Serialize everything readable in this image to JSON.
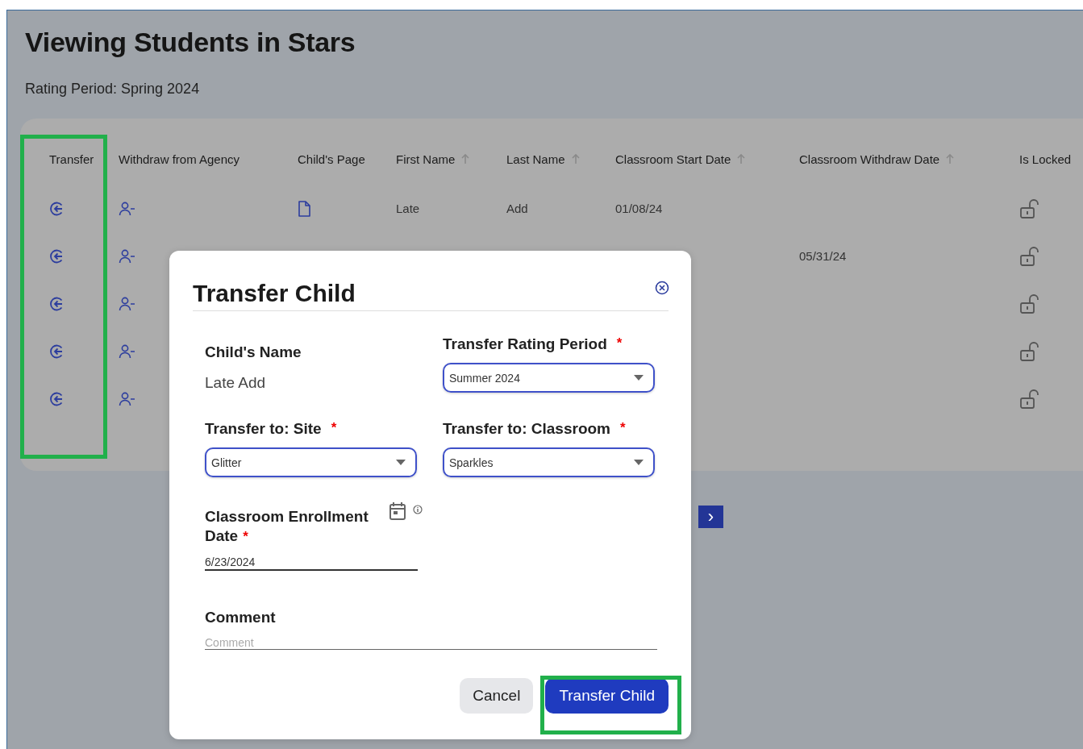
{
  "page": {
    "title": "Viewing Students in Stars",
    "subtitle": "Rating Period: Spring 2024"
  },
  "table": {
    "columns": [
      {
        "label": "Transfer",
        "sortable": false
      },
      {
        "label": "Withdraw from Agency",
        "sortable": false
      },
      {
        "label": "Child's Page",
        "sortable": false
      },
      {
        "label": "First Name",
        "sortable": true
      },
      {
        "label": "Last Name",
        "sortable": true
      },
      {
        "label": "Classroom Start Date",
        "sortable": true
      },
      {
        "label": "Classroom Withdraw Date",
        "sortable": true
      },
      {
        "label": "Is Locked",
        "sortable": false
      }
    ],
    "rows": [
      {
        "page_link": true,
        "first_name": "Late",
        "last_name": "Add",
        "start_date": "01/08/24",
        "locked": false
      },
      {
        "withdraw_date": "05/31/24",
        "locked": false
      },
      {
        "locked": false
      },
      {
        "locked": false
      },
      {
        "locked": false
      }
    ]
  },
  "pagination": {
    "next": "›"
  },
  "dialog": {
    "title": "Transfer Child",
    "childs_name_label": "Child's Name",
    "childs_name": "Late Add",
    "rating_period": {
      "label": "Transfer Rating Period",
      "required_mark": "*",
      "value": "Summer 2024"
    },
    "site": {
      "label": "Transfer to: Site",
      "required_mark": "*",
      "value": "Glitter"
    },
    "classroom": {
      "label": "Transfer to: Classroom",
      "required_mark": "*",
      "value": "Sparkles"
    },
    "enrollment_date": {
      "label": "Classroom Enrollment Date",
      "required_mark": "*",
      "value": "6/23/2024"
    },
    "comment": {
      "label": "Comment",
      "placeholder": "Comment"
    },
    "buttons": [
      {
        "label": "Cancel",
        "kind": "secondary"
      },
      {
        "label": "Transfer Child",
        "kind": "primary"
      }
    ]
  }
}
